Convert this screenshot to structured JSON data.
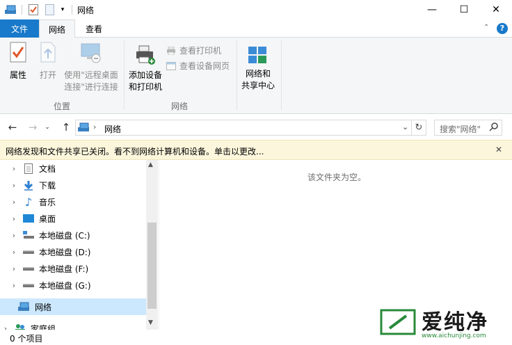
{
  "window": {
    "title": "网络",
    "controls": {
      "minimize": "—",
      "maximize": "☐",
      "close": "✕"
    }
  },
  "tabs": {
    "file": "文件",
    "network": "网络",
    "view": "查看"
  },
  "ribbon": {
    "location_group": {
      "label": "位置",
      "properties": "属性",
      "open": "打开",
      "remote_line1": "使用\"远程桌面",
      "remote_line2": "连接\"进行连接"
    },
    "network_group": {
      "label": "网络",
      "add_device_line1": "添加设备",
      "add_device_line2": "和打印机",
      "view_printers": "查看打印机",
      "view_device_webpage": "查看设备网页"
    },
    "sharing_center_line1": "网络和",
    "sharing_center_line2": "共享中心"
  },
  "address": {
    "current": "网络",
    "search_placeholder": "搜索\"网络\""
  },
  "infobar": {
    "message": "网络发现和文件共享已关闭。看不到网络计算机和设备。单击以更改...",
    "close": "✕"
  },
  "nav_items": [
    {
      "label": "文档",
      "icon": "document-icon"
    },
    {
      "label": "下载",
      "icon": "download-icon"
    },
    {
      "label": "音乐",
      "icon": "music-icon"
    },
    {
      "label": "桌面",
      "icon": "desktop-icon"
    },
    {
      "label": "本地磁盘 (C:)",
      "icon": "system-drive-icon"
    },
    {
      "label": "本地磁盘 (D:)",
      "icon": "drive-icon"
    },
    {
      "label": "本地磁盘 (F:)",
      "icon": "drive-icon"
    },
    {
      "label": "本地磁盘 (G:)",
      "icon": "drive-icon"
    },
    {
      "label": "网络",
      "icon": "network-icon"
    },
    {
      "label": "家庭组",
      "icon": "homegroup-icon"
    }
  ],
  "content": {
    "empty_message": "该文件夹为空。"
  },
  "status": {
    "item_count": "0 个项目"
  },
  "watermark": {
    "brand": "爱纯净",
    "url": "www.aichunjing.com"
  },
  "colors": {
    "accent": "#1979ca",
    "selected": "#cce8ff",
    "infobar": "#fcf6dc"
  }
}
